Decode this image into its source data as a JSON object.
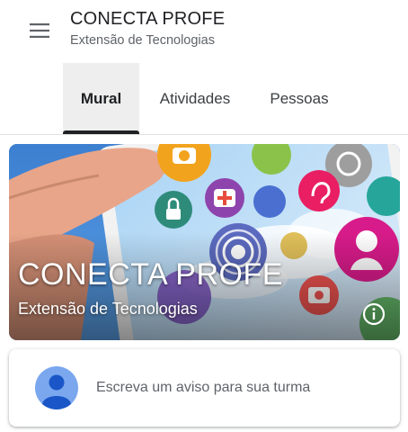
{
  "header": {
    "class_name": "CONECTA PROFE",
    "section": "Extensão de Tecnologias",
    "menu_icon": "hamburger-menu-icon"
  },
  "tabs": [
    {
      "label": "Mural",
      "active": true
    },
    {
      "label": "Atividades",
      "active": false
    },
    {
      "label": "Pessoas",
      "active": false
    }
  ],
  "banner": {
    "title": "CONECTA PROFE",
    "subtitle": "Extensão de Tecnologias",
    "info_icon": "info-icon"
  },
  "announce": {
    "placeholder": "Escreva um aviso para sua turma",
    "avatar_icon": "user-avatar-icon"
  },
  "colors": {
    "accent": "#202124",
    "active_tab_bg": "#eeeeee",
    "avatar_bg": "#7aa7ee"
  }
}
